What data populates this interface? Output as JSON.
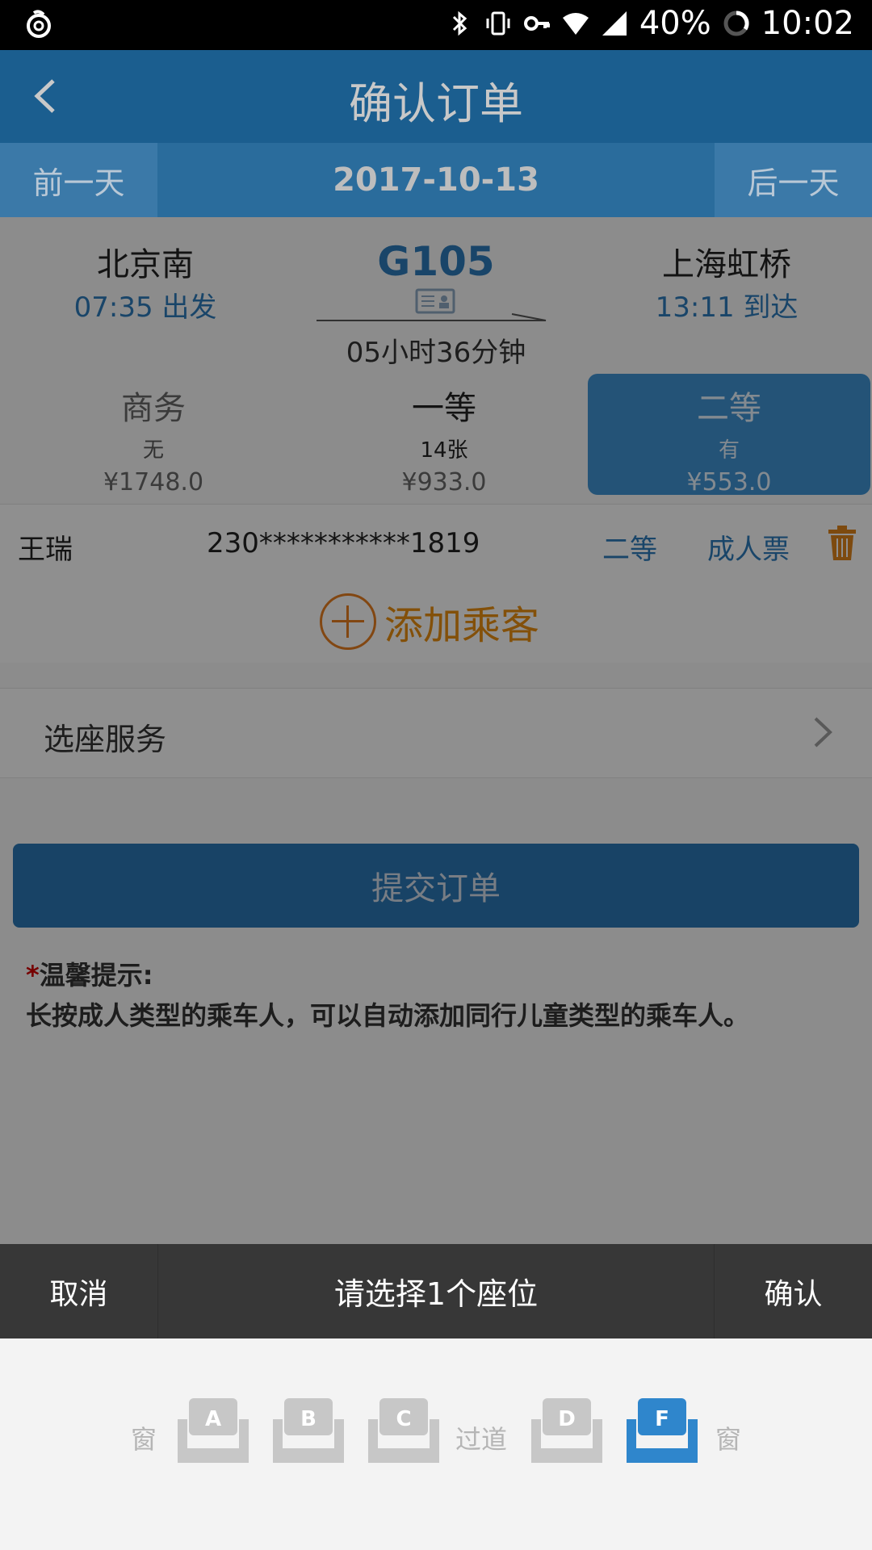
{
  "status": {
    "battery": "40%",
    "time": "10:02"
  },
  "header": {
    "title": "确认订单"
  },
  "datebar": {
    "prev": "前一天",
    "date": "2017-10-13",
    "next": "后一天"
  },
  "train": {
    "from": "北京南",
    "depart": "07:35 出发",
    "number": "G105",
    "duration": "05小时36分钟",
    "to": "上海虹桥",
    "arrive": "13:11 到达"
  },
  "seats": [
    {
      "type": "商务",
      "avail": "无",
      "price": "¥1748.0",
      "selected": false
    },
    {
      "type": "一等",
      "avail": "14张",
      "price": "¥933.0",
      "selected": false
    },
    {
      "type": "二等",
      "avail": "有",
      "price": "¥553.0",
      "selected": true
    }
  ],
  "passenger": {
    "name": "王瑞",
    "id": "230***********1819",
    "seat": "二等",
    "ticket": "成人票"
  },
  "add_passenger": "添加乘客",
  "seat_service": "选座服务",
  "submit": "提交订单",
  "tip": {
    "star": "*",
    "title": "温馨提示:",
    "text": "长按成人类型的乘车人，可以自动添加同行儿童类型的乘车人。"
  },
  "sheet": {
    "cancel": "取消",
    "prompt": "请选择1个座位",
    "confirm": "确认",
    "window_left": "窗",
    "aisle": "过道",
    "window_right": "窗",
    "seat_a": "A",
    "seat_b": "B",
    "seat_c": "C",
    "seat_d": "D",
    "seat_f": "F"
  },
  "colors": {
    "accent": "#2b77b5",
    "header": "#1b5e8f",
    "orange": "#e28a10",
    "selected_seat": "#2f86cc"
  }
}
